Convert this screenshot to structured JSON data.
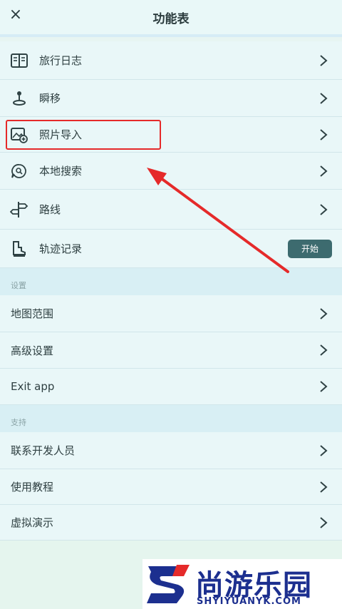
{
  "header": {
    "title": "功能表",
    "close_glyph": "×"
  },
  "menu": [
    {
      "label": "旅行日志",
      "icon": "journal-icon"
    },
    {
      "label": "瞬移",
      "icon": "teleport-icon"
    },
    {
      "label": "照片导入",
      "icon": "photo-import-icon"
    },
    {
      "label": "本地搜索",
      "icon": "local-search-icon"
    },
    {
      "label": "路线",
      "icon": "signpost-icon"
    },
    {
      "label": "轨迹记录",
      "icon": "track-record-icon",
      "button": "开始"
    }
  ],
  "settings": {
    "title": "设置",
    "items": [
      {
        "label": "地图范围"
      },
      {
        "label": "高级设置"
      },
      {
        "label": "Exit app"
      }
    ]
  },
  "support": {
    "title": "支持",
    "items": [
      {
        "label": "联系开发人员"
      },
      {
        "label": "使用教程"
      },
      {
        "label": "虚拟演示"
      }
    ]
  },
  "watermark": {
    "text": "尚游乐园",
    "url": "SHYIYUANYK.COM"
  },
  "colors": {
    "accent_button": "#3d6b6f",
    "highlight": "#e52a2a",
    "row_bg": "#e9f7f8"
  }
}
